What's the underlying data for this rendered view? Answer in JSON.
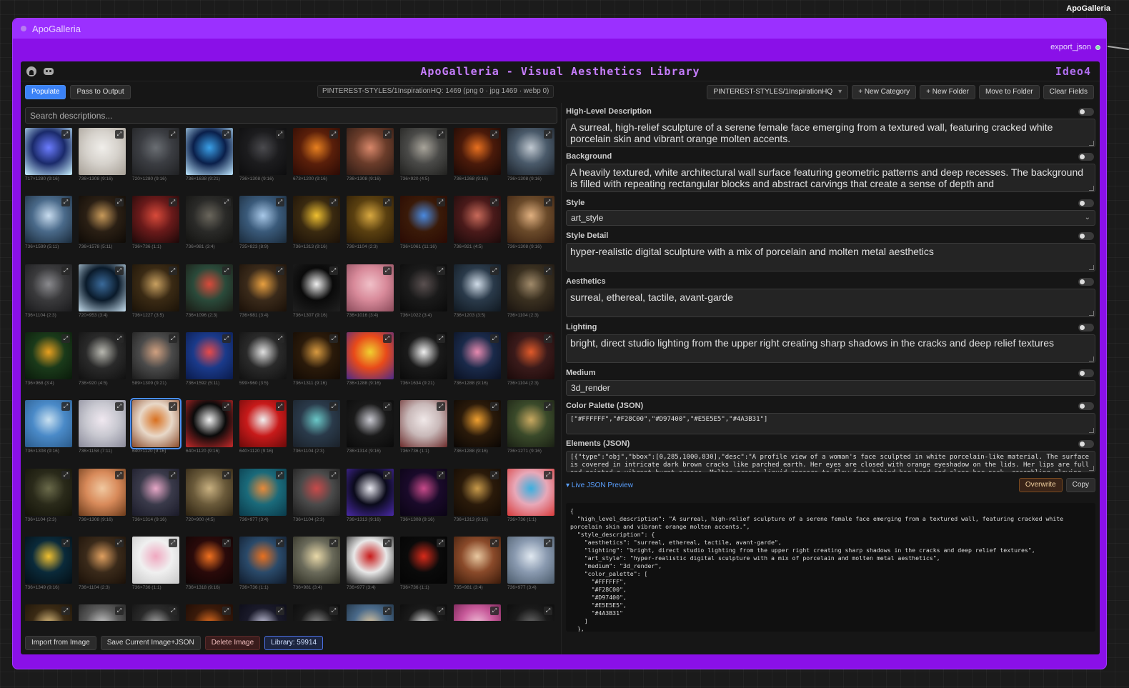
{
  "canvas": {
    "title": "ApoGalleria"
  },
  "node": {
    "title": "ApoGalleria",
    "output_label": "export_json"
  },
  "app": {
    "title": "ApoGalleria - Visual Aesthetics Library",
    "brand": "Ideo4"
  },
  "toolbar": {
    "populate": "Populate",
    "pass_to_output": "Pass to Output",
    "status": "PINTEREST-STYLES/1InspirationHQ: 1469 (png 0 · jpg 1469 · webp 0)",
    "folder_select": "PINTEREST-STYLES/1InspirationHQ",
    "new_category": "+ New Category",
    "new_folder": "+ New Folder",
    "move_to_folder": "Move to Folder",
    "clear_fields": "Clear Fields"
  },
  "search": {
    "placeholder": "Search descriptions..."
  },
  "gallery": {
    "tiles": [
      {
        "dims": "717×1280 (9:16)",
        "c1": "#1a2a6a",
        "c2": "#6b7cff",
        "c3": "#c9f2ff"
      },
      {
        "dims": "736×1308 (9:16)",
        "c1": "#d6d2cc",
        "c2": "#f0eeea",
        "c3": "#a69f96"
      },
      {
        "dims": "720×1280 (9:16)",
        "c1": "#3b3d42",
        "c2": "#6a6e73",
        "c3": "#1f2022"
      },
      {
        "dims": "736×1638 (9:21)",
        "c1": "#0a1f4a",
        "c2": "#3aa0e8",
        "c3": "#bfe8ff"
      },
      {
        "dims": "736×1308 (9:16)",
        "c1": "#1c1c1e",
        "c2": "#4a4a4e",
        "c3": "#0d0d0e"
      },
      {
        "dims": "673×1200 (9:16)",
        "c1": "#5a1f0a",
        "c2": "#e8801f",
        "c3": "#2a0a05"
      },
      {
        "dims": "736×1308 (9:16)",
        "c1": "#6a3c2a",
        "c2": "#d8876a",
        "c3": "#2c1a14"
      },
      {
        "dims": "736×920 (4:5)",
        "c1": "#4a4a48",
        "c2": "#a8a49a",
        "c3": "#20201e"
      },
      {
        "dims": "736×1268 (9:16)",
        "c1": "#4a1a0a",
        "c2": "#e8701f",
        "c3": "#1a0805"
      },
      {
        "dims": "736×1308 (9:16)",
        "c1": "#4a5a6a",
        "c2": "#c0c8d0",
        "c3": "#1a2028"
      },
      {
        "dims": "736×1599 (5:11)",
        "c1": "#4a6a8a",
        "c2": "#c8dcef",
        "c3": "#1a2a3a"
      },
      {
        "dims": "736×1578 (5:11)",
        "c1": "#2a1f14",
        "c2": "#c89a5a",
        "c3": "#0e0a06"
      },
      {
        "dims": "736×736 (1:1)",
        "c1": "#6a1a1a",
        "c2": "#d84a3a",
        "c3": "#1a0808"
      },
      {
        "dims": "736×981 (3:4)",
        "c1": "#2a2a28",
        "c2": "#6a665c",
        "c3": "#121210"
      },
      {
        "dims": "735×823 (8:9)",
        "c1": "#3a5a7a",
        "c2": "#a8c8e8",
        "c3": "#1a2a3a"
      },
      {
        "dims": "736×1313 (9:16)",
        "c1": "#3a2a10",
        "c2": "#f0c030",
        "c3": "#1a1008"
      },
      {
        "dims": "736×1104 (2:3)",
        "c1": "#5a4010",
        "c2": "#d8a840",
        "c3": "#2a1a06"
      },
      {
        "dims": "736×1061 (11:16)",
        "c1": "#3a1a08",
        "c2": "#4a8ae0",
        "c3": "#2a0a04"
      },
      {
        "dims": "736×921 (4:5)",
        "c1": "#4a1a1a",
        "c2": "#c86a5a",
        "c3": "#1a0a0a"
      },
      {
        "dims": "736×1308 (9:16)",
        "c1": "#6a4a2a",
        "c2": "#e0b080",
        "c3": "#3a2010"
      },
      {
        "dims": "736×1104 (2:3)",
        "c1": "#3a3a3c",
        "c2": "#8a8a8e",
        "c3": "#1a1a1c"
      },
      {
        "dims": "720×953 (3:4)",
        "c1": "#0a1a2a",
        "c2": "#3a6a9a",
        "c3": "#c8e0f0"
      },
      {
        "dims": "736×1227 (3:5)",
        "c1": "#3a2a14",
        "c2": "#c8a060",
        "c3": "#1a1208"
      },
      {
        "dims": "736×1096 (2:3)",
        "c1": "#2a4a3a",
        "c2": "#d84a3a",
        "c3": "#1a1a14"
      },
      {
        "dims": "736×981 (3:4)",
        "c1": "#3a2a1a",
        "c2": "#e8a040",
        "c3": "#1a1008"
      },
      {
        "dims": "736×1307 (9:16)",
        "c1": "#0a0a0a",
        "c2": "#f0f0f0",
        "c3": "#202020"
      },
      {
        "dims": "736×1016 (3:4)",
        "c1": "#d88a9a",
        "c2": "#f0c0c8",
        "c3": "#8a4a5a"
      },
      {
        "dims": "736×1022 (3:4)",
        "c1": "#1a1a1a",
        "c2": "#5a5050",
        "c3": "#0a0a0a"
      },
      {
        "dims": "736×1203 (3:5)",
        "c1": "#2a3a4a",
        "c2": "#d0dce8",
        "c3": "#101820"
      },
      {
        "dims": "736×1104 (2:3)",
        "c1": "#3a3020",
        "c2": "#a08a6a",
        "c3": "#1a1410"
      },
      {
        "dims": "736×968 (3:4)",
        "c1": "#1a3a1a",
        "c2": "#e8a020",
        "c3": "#0a1a0a"
      },
      {
        "dims": "736×920 (4:5)",
        "c1": "#2a2a2a",
        "c2": "#b8b8b0",
        "c3": "#101010"
      },
      {
        "dims": "589×1309 (9:21)",
        "c1": "#4a4a4a",
        "c2": "#d0a080",
        "c3": "#1a1a1a"
      },
      {
        "dims": "736×1592 (5:11)",
        "c1": "#1a3a8a",
        "c2": "#e84a4a",
        "c3": "#0a1a4a"
      },
      {
        "dims": "599×960 (3:5)",
        "c1": "#2a2a2a",
        "c2": "#e0e0e0",
        "c3": "#101010"
      },
      {
        "dims": "736×1311 (9:16)",
        "c1": "#2a1a0a",
        "c2": "#d89a40",
        "c3": "#120a04"
      },
      {
        "dims": "736×1288 (9:16)",
        "c1": "#e84a1a",
        "c2": "#f0d030",
        "c3": "#4a2a8a"
      },
      {
        "dims": "736×1634 (9:21)",
        "c1": "#1a1a1a",
        "c2": "#f0f0f0",
        "c3": "#0a0a0a"
      },
      {
        "dims": "736×1288 (9:16)",
        "c1": "#1a2a4a",
        "c2": "#e88ab0",
        "c3": "#0a1020"
      },
      {
        "dims": "736×1104 (2:3)",
        "c1": "#3a1a1a",
        "c2": "#e05a2a",
        "c3": "#1a0a0a"
      },
      {
        "dims": "736×1308 (9:16)",
        "c1": "#4a8ac8",
        "c2": "#c8e0f0",
        "c3": "#2a5a8a"
      },
      {
        "dims": "736×1158 (7:11)",
        "c1": "#c8c8d0",
        "c2": "#f0e8f0",
        "c3": "#8a8a9a"
      },
      {
        "dims": "640×1120 (9:16)",
        "c1": "#e8d8c8",
        "c2": "#d8701f",
        "c3": "#8a4a2a"
      },
      {
        "dims": "640×1120 (9:16)",
        "c1": "#0a0a0a",
        "c2": "#f0f0f0",
        "c3": "#c82a2a"
      },
      {
        "dims": "640×1120 (9:16)",
        "c1": "#c81a1a",
        "c2": "#f0f0f0",
        "c3": "#6a0a0a"
      },
      {
        "dims": "736×1104 (2:3)",
        "c1": "#2a3a4a",
        "c2": "#6ac8c8",
        "c3": "#1a2028"
      },
      {
        "dims": "736×1314 (9:16)",
        "c1": "#1a1a1a",
        "c2": "#c8c8d0",
        "c3": "#0a0a0a"
      },
      {
        "dims": "736×736 (1:1)",
        "c1": "#c8b8b8",
        "c2": "#f0e8e8",
        "c3": "#6a2a2a"
      },
      {
        "dims": "736×1288 (9:16)",
        "c1": "#2a1a0a",
        "c2": "#f0a030",
        "c3": "#0a0604"
      },
      {
        "dims": "736×1271 (9:16)",
        "c1": "#3a4a2a",
        "c2": "#c8a860",
        "c3": "#1a2014"
      },
      {
        "dims": "736×1104 (2:3)",
        "c1": "#2a2a1a",
        "c2": "#6a6a4a",
        "c3": "#121208"
      },
      {
        "dims": "736×1308 (9:16)",
        "c1": "#d88a5a",
        "c2": "#f0c8a0",
        "c3": "#6a3a1a"
      },
      {
        "dims": "736×1314 (9:16)",
        "c1": "#3a3a4a",
        "c2": "#e8a8c8",
        "c3": "#1a1a28"
      },
      {
        "dims": "720×900 (4:5)",
        "c1": "#6a5a3a",
        "c2": "#c8b080",
        "c3": "#2a2010"
      },
      {
        "dims": "736×977 (3:4)",
        "c1": "#1a6a7a",
        "c2": "#e88a3a",
        "c3": "#0a3a4a"
      },
      {
        "dims": "736×1104 (2:3)",
        "c1": "#4a4a4a",
        "c2": "#c84a4a",
        "c3": "#1a1a1a"
      },
      {
        "dims": "736×1313 (9:16)",
        "c1": "#0a0a1a",
        "c2": "#e8e8f0",
        "c3": "#4a2aa8"
      },
      {
        "dims": "736×1308 (9:16)",
        "c1": "#1a0a2a",
        "c2": "#c84a8a",
        "c3": "#0a0414"
      },
      {
        "dims": "736×1313 (9:16)",
        "c1": "#2a1a0a",
        "c2": "#c89a4a",
        "c3": "#120a04"
      },
      {
        "dims": "736×736 (1:1)",
        "c1": "#e8a8b8",
        "c2": "#3ab0e0",
        "c3": "#d83a3a"
      },
      {
        "dims": "736×1349 (9:16)",
        "c1": "#0a2a3a",
        "c2": "#f0c030",
        "c3": "#040e14"
      },
      {
        "dims": "736×1104 (2:3)",
        "c1": "#3a2a1a",
        "c2": "#e0a060",
        "c3": "#1a1008"
      },
      {
        "dims": "736×736 (1:1)",
        "c1": "#f0f0f0",
        "c2": "#f0a8c0",
        "c3": "#c8c8c8"
      },
      {
        "dims": "736×1318 (9:16)",
        "c1": "#2a0a0a",
        "c2": "#f0701f",
        "c3": "#0e0404"
      },
      {
        "dims": "736×736 (1:1)",
        "c1": "#2a4a6a",
        "c2": "#e8701f",
        "c3": "#101a2a"
      },
      {
        "dims": "736×981 (3:4)",
        "c1": "#6a6a5a",
        "c2": "#e8d8a8",
        "c3": "#2a2a20"
      },
      {
        "dims": "736×977 (3:4)",
        "c1": "#e8e8e8",
        "c2": "#c81a1a",
        "c3": "#1a1a1a"
      },
      {
        "dims": "736×736 (1:1)",
        "c1": "#0a0a0a",
        "c2": "#d82a1a",
        "c3": "#040404"
      },
      {
        "dims": "735×981 (3:4)",
        "c1": "#8a4a2a",
        "c2": "#e8c8a0",
        "c3": "#3a1a0a"
      },
      {
        "dims": "736×977 (3:4)",
        "c1": "#8a9ab0",
        "c2": "#e0e8f0",
        "c3": "#4a5a6a"
      },
      {
        "dims": "",
        "c1": "#3a2a14",
        "c2": "#e0c080",
        "c3": "#1a1208"
      },
      {
        "dims": "",
        "c1": "#5a5a5a",
        "c2": "#c8c8c8",
        "c3": "#1a1a1a"
      },
      {
        "dims": "",
        "c1": "#2a2a2a",
        "c2": "#a8a8a8",
        "c3": "#101010"
      },
      {
        "dims": "",
        "c1": "#3a1a0a",
        "c2": "#e8701f",
        "c3": "#1a0a04"
      },
      {
        "dims": "",
        "c1": "#1a1a2a",
        "c2": "#c8c8e0",
        "c3": "#0a0a14"
      },
      {
        "dims": "",
        "c1": "#1a1a1a",
        "c2": "#8a8a8a",
        "c3": "#0a0a0a"
      },
      {
        "dims": "",
        "c1": "#4a6a8a",
        "c2": "#e0c8a0",
        "c3": "#1a2a3a"
      },
      {
        "dims": "",
        "c1": "#1a1a1a",
        "c2": "#e8e8e8",
        "c3": "#0a0a0a"
      },
      {
        "dims": "",
        "c1": "#c85a9a",
        "c2": "#f0c0d8",
        "c3": "#6a1a4a"
      },
      {
        "dims": "",
        "c1": "#1a1a1a",
        "c2": "#6a6a6a",
        "c3": "#0a0a0a"
      }
    ],
    "selected_index": 42
  },
  "bottom": {
    "import": "Import from Image",
    "save": "Save Current Image+JSON",
    "delete": "Delete Image",
    "library": "Library: 59914"
  },
  "fields": {
    "high_level": {
      "label": "High-Level Description",
      "value": "A surreal, high-relief sculpture of a serene female face emerging from a textured wall, featuring cracked white porcelain skin and vibrant orange molten accents."
    },
    "background": {
      "label": "Background",
      "value": "A heavily textured, white architectural wall surface featuring geometric patterns and deep recesses. The background is filled with repeating rectangular blocks and abstract carvings that create a sense of depth and"
    },
    "style": {
      "label": "Style",
      "value": "art_style"
    },
    "style_detail": {
      "label": "Style Detail",
      "value": "hyper-realistic digital sculpture with a mix of porcelain and molten metal aesthetics"
    },
    "aesthetics": {
      "label": "Aesthetics",
      "value": "surreal, ethereal, tactile, avant-garde"
    },
    "lighting": {
      "label": "Lighting",
      "value": "bright, direct studio lighting from the upper right creating sharp shadows in the cracks and deep relief textures"
    },
    "medium": {
      "label": "Medium",
      "value": "3d_render"
    },
    "color_palette": {
      "label": "Color Palette (JSON)",
      "value": "[\"#FFFFFF\",\"#F28C00\",\"#D97400\",\"#E5E5E5\",\"#4A3B31\"]"
    },
    "elements": {
      "label": "Elements (JSON)",
      "value": "[{\"type\":\"obj\",\"bbox\":[0,285,1000,830],\"desc\":\"A profile view of a woman's face sculpted in white porcelain-like material. The surface is covered in intricate dark brown cracks like parched earth. Her eyes are closed with orange eyeshadow on the lids. Her lips are full and painted a vibrant burnt orange. Molten orange liquid appears to flow from behind her head and along her neck, resembling glowing lava or liquid"
    }
  },
  "live": {
    "toggle_label": "▾ Live JSON Preview",
    "overwrite": "Overwrite",
    "copy": "Copy",
    "preview": "{\n  \"high_level_description\": \"A surreal, high-relief sculpture of a serene female face emerging from a textured wall, featuring cracked white porcelain skin and vibrant orange molten accents.\",\n  \"style_description\": {\n    \"aesthetics\": \"surreal, ethereal, tactile, avant-garde\",\n    \"lighting\": \"bright, direct studio lighting from the upper right creating sharp shadows in the cracks and deep relief textures\",\n    \"art_style\": \"hyper-realistic digital sculpture with a mix of porcelain and molten metal aesthetics\",\n    \"medium\": \"3d_render\",\n    \"color_palette\": [\n      \"#FFFFFF\",\n      \"#F28C00\",\n      \"#D97400\",\n      \"#E5E5E5\",\n      \"#4A3B31\"\n    ]\n  },"
  },
  "colors": {
    "node_purple": "#8a10e8",
    "accent_blue": "#3b82f6",
    "title_purple": "#c77dff"
  }
}
